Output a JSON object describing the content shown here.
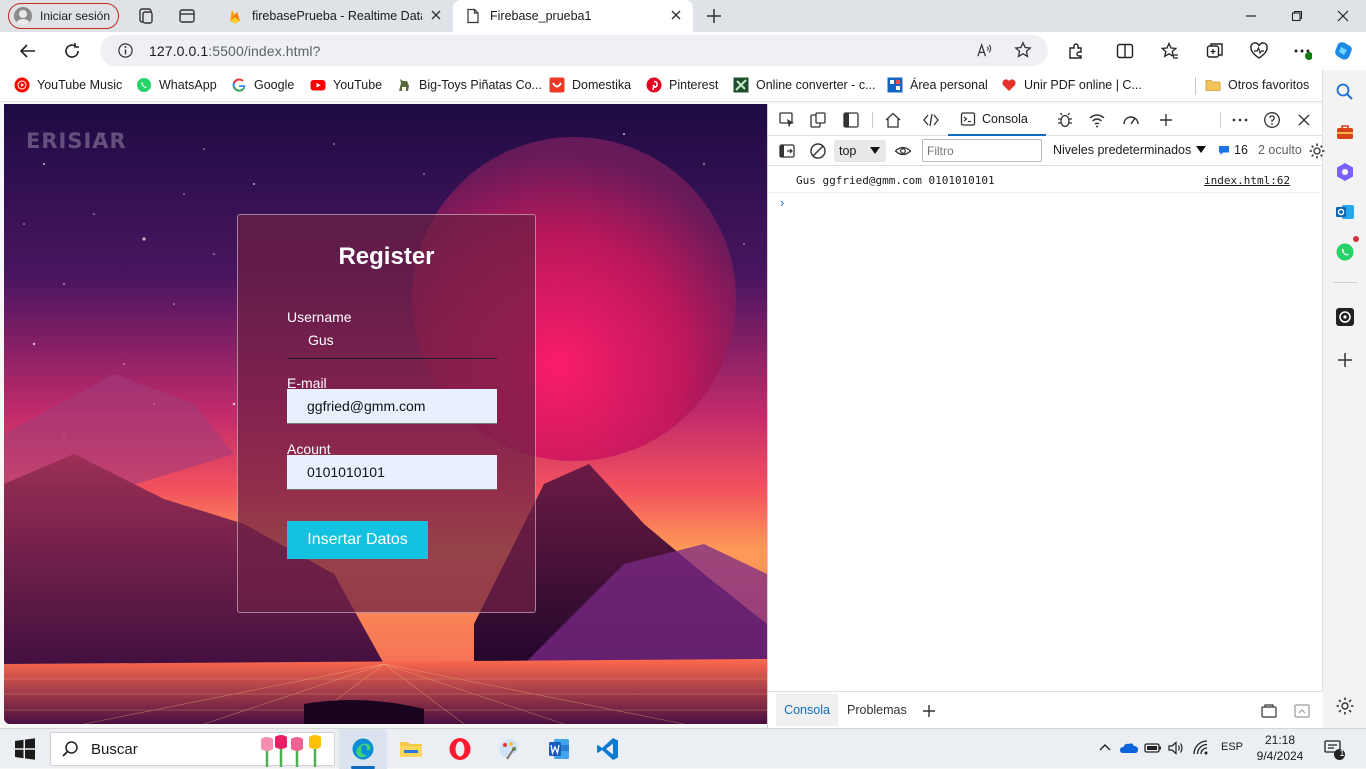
{
  "browser": {
    "profile_label": "Iniciar sesión",
    "tabs": [
      {
        "title": "firebasePrueba - Realtime Database",
        "active": false
      },
      {
        "title": "Firebase_prueba1",
        "active": true
      }
    ],
    "url_host": "127.0.0.1",
    "url_rest": ":5500/index.html?",
    "bookmarks": [
      "YouTube Music",
      "WhatsApp",
      "Google",
      "YouTube",
      "Big-Toys Piñatas Co...",
      "Domestika",
      "Pinterest",
      "Online converter - c...",
      "Área personal",
      "Unir PDF online | C...",
      "Otros favoritos"
    ]
  },
  "page": {
    "brand": "ERISIAR",
    "form": {
      "title": "Register",
      "username_label": "Username",
      "username_value": "Gus",
      "email_label": "E-mail",
      "email_value": "ggfried@gmm.com",
      "account_label": "Acount",
      "account_value": "0101010101",
      "submit_label": "Insertar Datos"
    }
  },
  "devtools": {
    "console_tab": "Consola",
    "context": "top",
    "filter_placeholder": "Filtro",
    "levels": "Niveles predeterminados",
    "message_count": "16",
    "hidden_count": "2 oculto",
    "log_message": "Gus ggfried@gmm.com 0101010101",
    "log_source": "index.html:62",
    "prompt": "›",
    "drawer_tabs": [
      "Consola",
      "Problemas"
    ]
  },
  "taskbar": {
    "search_placeholder": "Buscar",
    "language": "ESP",
    "time": "21:18",
    "date": "9/4/2024",
    "notification_count": "1"
  },
  "colors": {
    "accent": "#0f6cbd",
    "submit_button": "#12c2e0",
    "input_bg": "#e8f0fe"
  }
}
